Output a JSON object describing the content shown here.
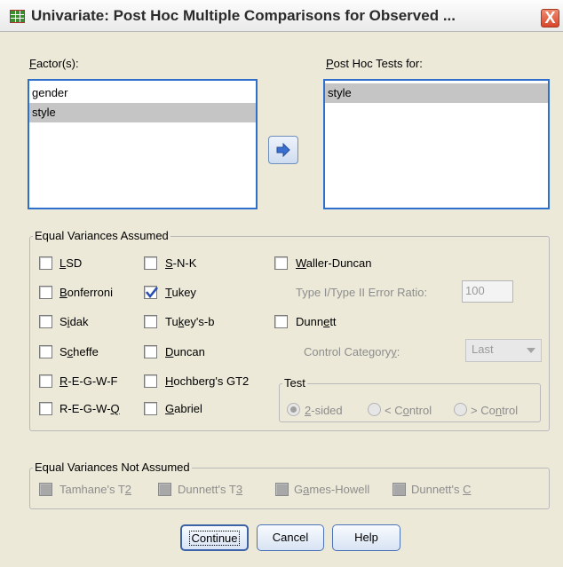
{
  "window": {
    "title": "Univariate: Post Hoc Multiple Comparisons for Observed ...",
    "close_glyph": "X"
  },
  "factors": {
    "label_pre": "",
    "label_key": "F",
    "label_post": "actor(s):",
    "items": [
      "gender",
      "style"
    ],
    "selected_index": 1
  },
  "move_button": {
    "icon": "arrow-right-icon"
  },
  "posthoc": {
    "label_pre": "",
    "label_key": "P",
    "label_post": "ost Hoc Tests for:",
    "items": [
      "style"
    ]
  },
  "equal_var": {
    "title": "Equal Variances Assumed",
    "col1": [
      {
        "pre": "",
        "key": "L",
        "post": "SD",
        "checked": false
      },
      {
        "pre": "",
        "key": "B",
        "post": "onferroni",
        "checked": false
      },
      {
        "pre": "S",
        "key": "i",
        "post": "dak",
        "checked": false
      },
      {
        "pre": "S",
        "key": "c",
        "post": "heffe",
        "checked": false
      },
      {
        "pre": "",
        "key": "R",
        "post": "-E-G-W-F",
        "checked": false
      },
      {
        "pre": "R-E-G-W-",
        "key": "Q",
        "post": "",
        "checked": false
      }
    ],
    "col2": [
      {
        "pre": "",
        "key": "S",
        "post": "-N-K",
        "checked": false
      },
      {
        "pre": "",
        "key": "T",
        "post": "ukey",
        "checked": true
      },
      {
        "pre": "Tu",
        "key": "k",
        "post": "ey's-b",
        "checked": false
      },
      {
        "pre": "",
        "key": "D",
        "post": "uncan",
        "checked": false
      },
      {
        "pre": "",
        "key": "H",
        "post": "ochberg's GT2",
        "checked": false
      },
      {
        "pre": "",
        "key": "G",
        "post": "abriel",
        "checked": false
      }
    ],
    "waller": {
      "pre": "",
      "key": "W",
      "post": "aller-Duncan",
      "checked": false
    },
    "ratio_label": "Type I/Type II Error Ratio:",
    "ratio_value": "100",
    "dunnett": {
      "pre": "Dunn",
      "key": "e",
      "post": "tt",
      "checked": false
    },
    "control_label_pre": "Control Category",
    "control_label_key": "y",
    "control_label_post": ":",
    "control_value": "Last",
    "test": {
      "title": "Test",
      "options": [
        {
          "pre": "",
          "key": "2",
          "post": "-sided",
          "on": true
        },
        {
          "pre": "< C",
          "key": "o",
          "post": "ntrol",
          "on": false
        },
        {
          "pre": "> Co",
          "key": "n",
          "post": "trol",
          "on": false
        }
      ]
    }
  },
  "not_equal_var": {
    "title": "Equal Variances Not Assumed",
    "items": [
      {
        "pre": "Tamhane's T",
        "key": "2",
        "post": ""
      },
      {
        "pre": "Dunnett's T",
        "key": "3",
        "post": ""
      },
      {
        "pre": "G",
        "key": "a",
        "post": "mes-Howell"
      },
      {
        "pre": "Dunnett's ",
        "key": "C",
        "post": ""
      }
    ]
  },
  "buttons": {
    "continue": "Continue",
    "cancel": "Cancel",
    "help": "Help"
  },
  "colors": {
    "dialog_bg": "#ece9d8",
    "list_border": "#2e6fcc",
    "selection": "#c5c5c5",
    "check": "#2a4fb0"
  }
}
